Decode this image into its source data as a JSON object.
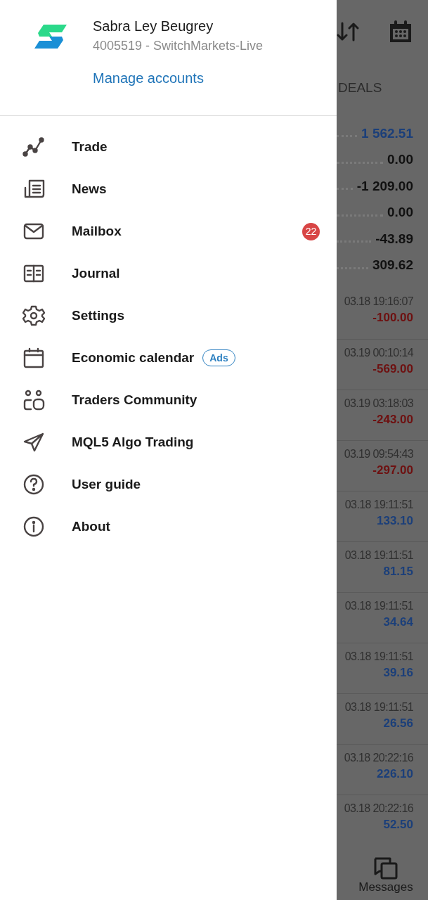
{
  "drawer": {
    "account": {
      "name": "Sabra Ley Beugrey",
      "number": "4005519 - SwitchMarkets-Live",
      "manage_link": "Manage accounts"
    },
    "menu": [
      {
        "kind": "trade",
        "label": "Trade"
      },
      {
        "kind": "news",
        "label": "News"
      },
      {
        "kind": "mailbox",
        "label": "Mailbox",
        "badge": "22"
      },
      {
        "kind": "journal",
        "label": "Journal"
      },
      {
        "kind": "settings",
        "label": "Settings"
      },
      {
        "kind": "calendar",
        "label": "Economic calendar",
        "tag": "Ads"
      },
      {
        "kind": "community",
        "label": "Traders Community"
      },
      {
        "kind": "algo",
        "label": "MQL5 Algo Trading"
      },
      {
        "kind": "guide",
        "label": "User guide"
      },
      {
        "kind": "about",
        "label": "About"
      }
    ]
  },
  "background": {
    "tab": "DEALS",
    "summary": [
      {
        "value": "1 562.51",
        "color": "#1b3f7a"
      },
      {
        "value": "0.00",
        "color": "#111111"
      },
      {
        "value": "-1 209.00",
        "color": "#111111"
      },
      {
        "value": "0.00",
        "color": "#111111"
      },
      {
        "value": "-43.89",
        "color": "#111111"
      },
      {
        "value": "309.62",
        "color": "#111111"
      }
    ],
    "deals": [
      {
        "time": "03.18 19:16:07",
        "amount": "-100.00",
        "color": "#6e1010"
      },
      {
        "time": "03.19 00:10:14",
        "amount": "-569.00",
        "color": "#6e1010"
      },
      {
        "time": "03.19 03:18:03",
        "amount": "-243.00",
        "color": "#6e1010"
      },
      {
        "time": "03.19 09:54:43",
        "amount": "-297.00",
        "color": "#6e1010"
      },
      {
        "time": "03.18 19:11:51",
        "amount": "133.10",
        "color": "#1b3f7a"
      },
      {
        "time": "03.18 19:11:51",
        "amount": "81.15",
        "color": "#1b3f7a"
      },
      {
        "time": "03.18 19:11:51",
        "amount": "34.64",
        "color": "#1b3f7a"
      },
      {
        "time": "03.18 19:11:51",
        "amount": "39.16",
        "color": "#1b3f7a"
      },
      {
        "time": "03.18 19:11:51",
        "amount": "26.56",
        "color": "#1b3f7a"
      },
      {
        "time": "03.18 20:22:16",
        "amount": "226.10",
        "color": "#1b3f7a"
      },
      {
        "time": "03.18 20:22:16",
        "amount": "52.50",
        "color": "#1b3f7a"
      }
    ],
    "bottom_tab": "Messages"
  }
}
